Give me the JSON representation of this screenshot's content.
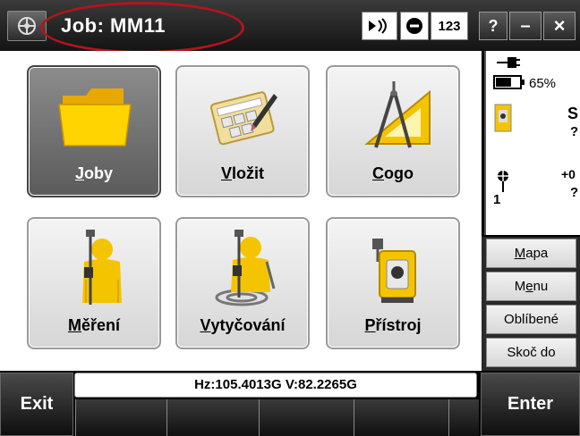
{
  "titlebar": {
    "job_title": "Job: MM11",
    "counter_label": "123",
    "help_label": "?",
    "minimize_label": "–",
    "close_label": "×"
  },
  "tiles": [
    {
      "label": "Joby",
      "underline": "J",
      "rest": "oby",
      "icon": "folder-icon",
      "selected": true
    },
    {
      "label": "Vložit",
      "underline": "V",
      "rest": "ložit",
      "icon": "keyboard-pen-icon",
      "selected": false
    },
    {
      "label": "Cogo",
      "underline": "C",
      "rest": "ogo",
      "icon": "compass-triangle-icon",
      "selected": false
    },
    {
      "label": "Měření",
      "underline": "M",
      "rest": "ěření",
      "icon": "surveyor-gnss-icon",
      "selected": false
    },
    {
      "label": "Vytyčování",
      "underline": "V",
      "rest": "ytyčování",
      "icon": "surveyor-stakeout-icon",
      "selected": false
    },
    {
      "label": "Přístroj",
      "underline": "P",
      "rest": "řístroj",
      "icon": "total-station-icon",
      "selected": false
    }
  ],
  "status": {
    "battery_percent": "65%",
    "battery_level": 0.65,
    "instrument_letter": "S",
    "instrument_value": "?",
    "target_offset": "+0",
    "target_value": "?",
    "target_number": "1"
  },
  "side_menu": [
    {
      "label": "Mapa",
      "underline": "M",
      "rest": "apa"
    },
    {
      "label": "Menu",
      "underline": "e",
      "pre": "M",
      "rest": "nu"
    },
    {
      "label": "Oblíbené",
      "underline": "",
      "rest": "Oblíbené"
    },
    {
      "label": "Skoč do",
      "underline": "",
      "rest": "Skoč do"
    }
  ],
  "bottom": {
    "status_line": "Hz:105.4013G  V:82.2265G",
    "exit_label": "Exit",
    "enter_label": "Enter"
  },
  "colors": {
    "highlight_ellipse": "#b3151a",
    "tile_selected": "#6e6e6e",
    "folder_yellow": "#f5c400"
  }
}
